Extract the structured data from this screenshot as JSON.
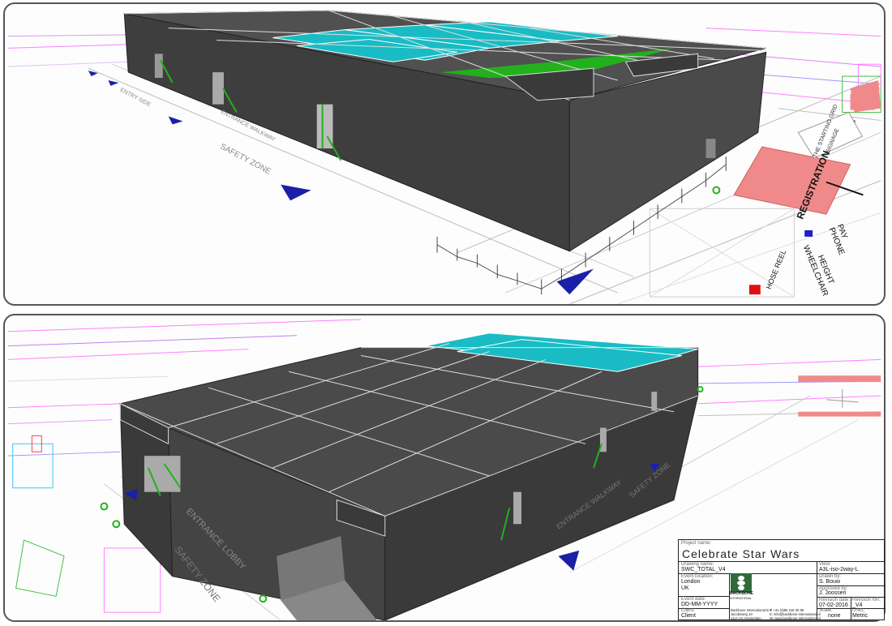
{
  "top_view": {
    "labels": {
      "registration": "REGISTRATION",
      "wheelchair": "WHEELCHAIR",
      "height": "HEIGHT",
      "pay_phone": "PAY PHONE",
      "hose_reel": "HOSE REEL",
      "the_starting_grid": "THE STARTING GRID",
      "signage": "SIGNAGE",
      "safety_zone": "SAFETY ZONE",
      "entrance_walkway": "ENTRANCE WALKWAY",
      "entry_side": "ENTRY SIDE"
    }
  },
  "bottom_view": {
    "labels": {
      "safety_zone": "SAFETY ZONE",
      "entrance_walkway": "ENTRANCE WALKWAY",
      "entrance_lobby": "ENTRANCE LOBBY",
      "safety_zone_right": "SAFETY ZONE"
    }
  },
  "title_block": {
    "project_name_label": "Project name:",
    "project_name": "Celebrate Star Wars",
    "drawing_name_label": "Drawing name:",
    "drawing_name": "SWC_TOTAL_V4",
    "view_label": "View:",
    "view": "A3L-iso-2way-L",
    "event_location_label": "Event location:",
    "event_location_line1": "London",
    "event_location_line2": "UK",
    "drawn_by_label": "Drawn by:",
    "drawn_by": "S. Bouw",
    "approved_by_label": "Approved by:",
    "approved_by": "J. Joossen",
    "event_date_label": "Event date:",
    "event_date": "DD-MM-YYYY",
    "revision_date_label": "Revision date:",
    "revision_date": "07-02-2016",
    "revision_nr_label": "Revision NR:",
    "revision_nr": "_V4",
    "client_label": "Client:",
    "client": "Client",
    "scale_label": "Scale:",
    "scale": "none",
    "units_label": "Units:",
    "units": "Metric",
    "logo_text": "BACKBONE",
    "logo_subtext": "INTERNATIONAL",
    "company_line1": "Backbone International B.V.",
    "company_line2": "Jacobsweg 10",
    "company_line3": "1114 AS Amsterdam",
    "phone_line": "T: +31 (0)85 316 30 85",
    "email_line": "E: info@backbone-international.nl",
    "web_line": "W: www.backbone-international.nl"
  },
  "colors": {
    "wall": "#434343",
    "wall_light": "#555555",
    "roof_cyan": "#19bcc4",
    "stair_green": "#22b11c",
    "registration_pink": "#f08a8a",
    "arrow_blue": "#1b1fa8",
    "hose_red": "#e01010"
  }
}
